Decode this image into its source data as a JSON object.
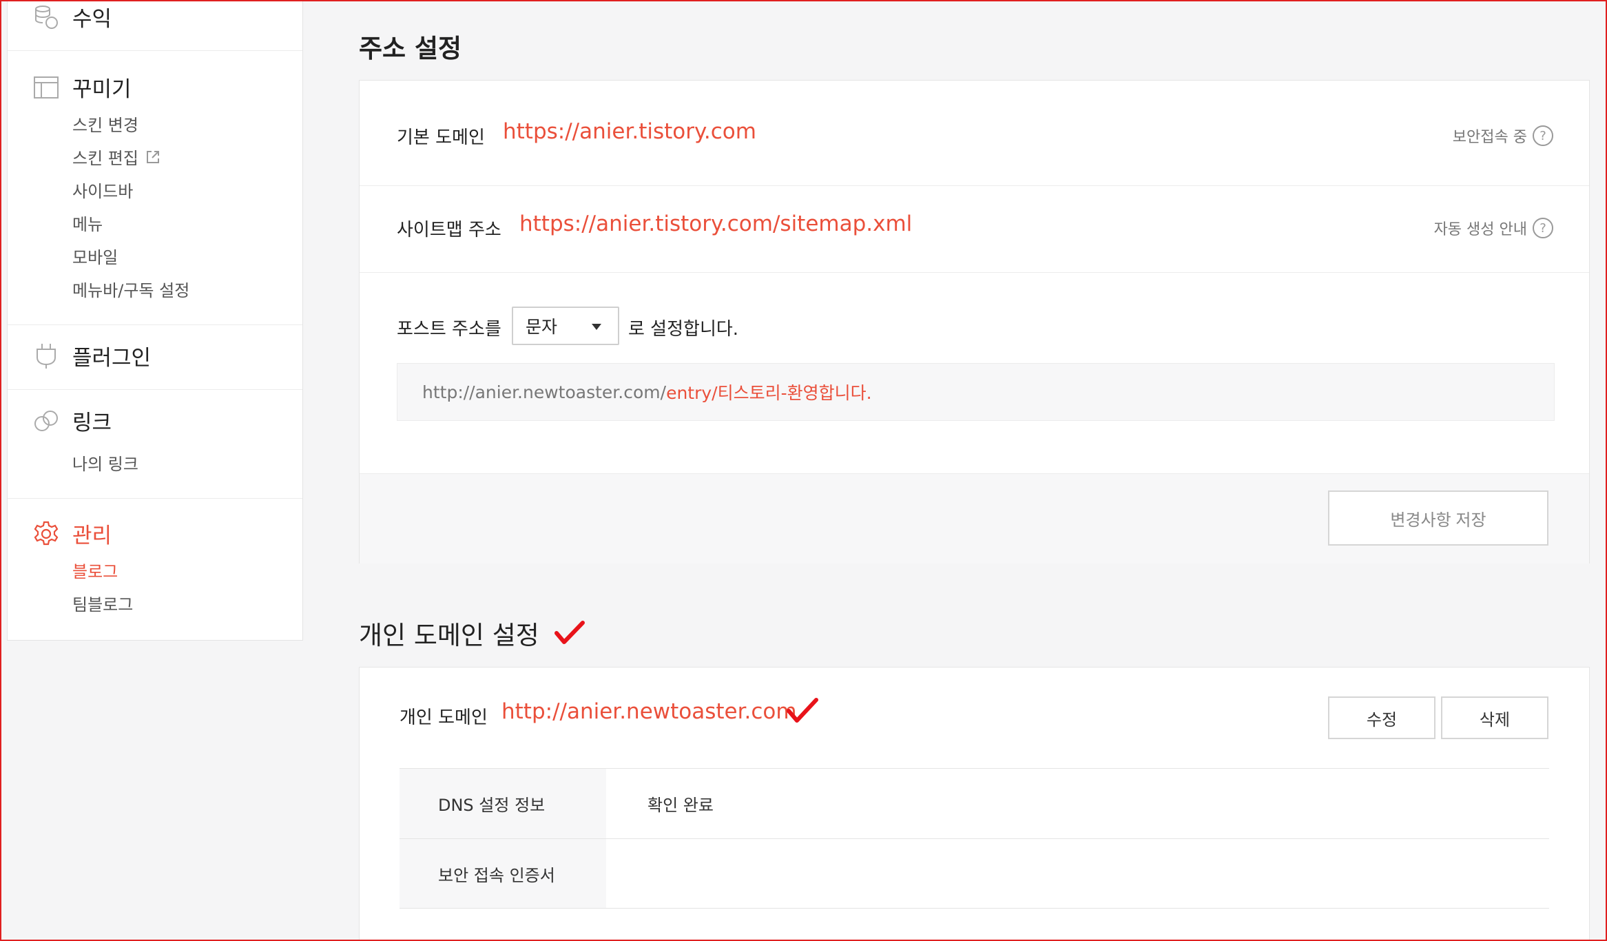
{
  "sidebar": {
    "revenue": {
      "label": "수익",
      "icon": "coins-icon"
    },
    "decorate": {
      "label": "꾸미기",
      "icon": "layout-icon",
      "items": [
        "스킨 변경",
        "스킨 편집",
        "사이드바",
        "메뉴",
        "모바일",
        "메뉴바/구독 설정"
      ]
    },
    "plugin": {
      "label": "플러그인",
      "icon": "plug-icon"
    },
    "link": {
      "label": "링크",
      "icon": "chain-link-icon",
      "items": [
        "나의 링크"
      ]
    },
    "manage": {
      "label": "관리",
      "icon": "gear-icon",
      "items": [
        "블로그",
        "팀블로그"
      ]
    }
  },
  "address": {
    "title": "주소 설정",
    "default_domain_label": "기본 도메인",
    "default_domain_value": "https://anier.tistory.com",
    "secure_status": "보안접속 중",
    "sitemap_label": "사이트맵 주소",
    "sitemap_value": "https://anier.tistory.com/sitemap.xml",
    "sitemap_help": "자동 생성 안내",
    "post_prefix": "포스트 주소를",
    "post_select_value": "문자",
    "post_suffix": "로 설정합니다.",
    "preview_base": "http://anier.newtoaster.com/",
    "preview_path": "entry/티스토리-환영합니다.",
    "save_button": "변경사항 저장",
    "help_glyph": "?"
  },
  "custom_domain": {
    "title": "개인 도메인 설정",
    "label": "개인 도메인",
    "value": "http://anier.newtoaster.com",
    "edit_button": "수정",
    "delete_button": "삭제",
    "rows": [
      {
        "key": "DNS 설정 정보",
        "value": "확인 완료"
      },
      {
        "key": "보안 접속 인증서",
        "value": ""
      }
    ]
  },
  "colors": {
    "accent": "#ea4f3a",
    "check": "#e8131a"
  }
}
